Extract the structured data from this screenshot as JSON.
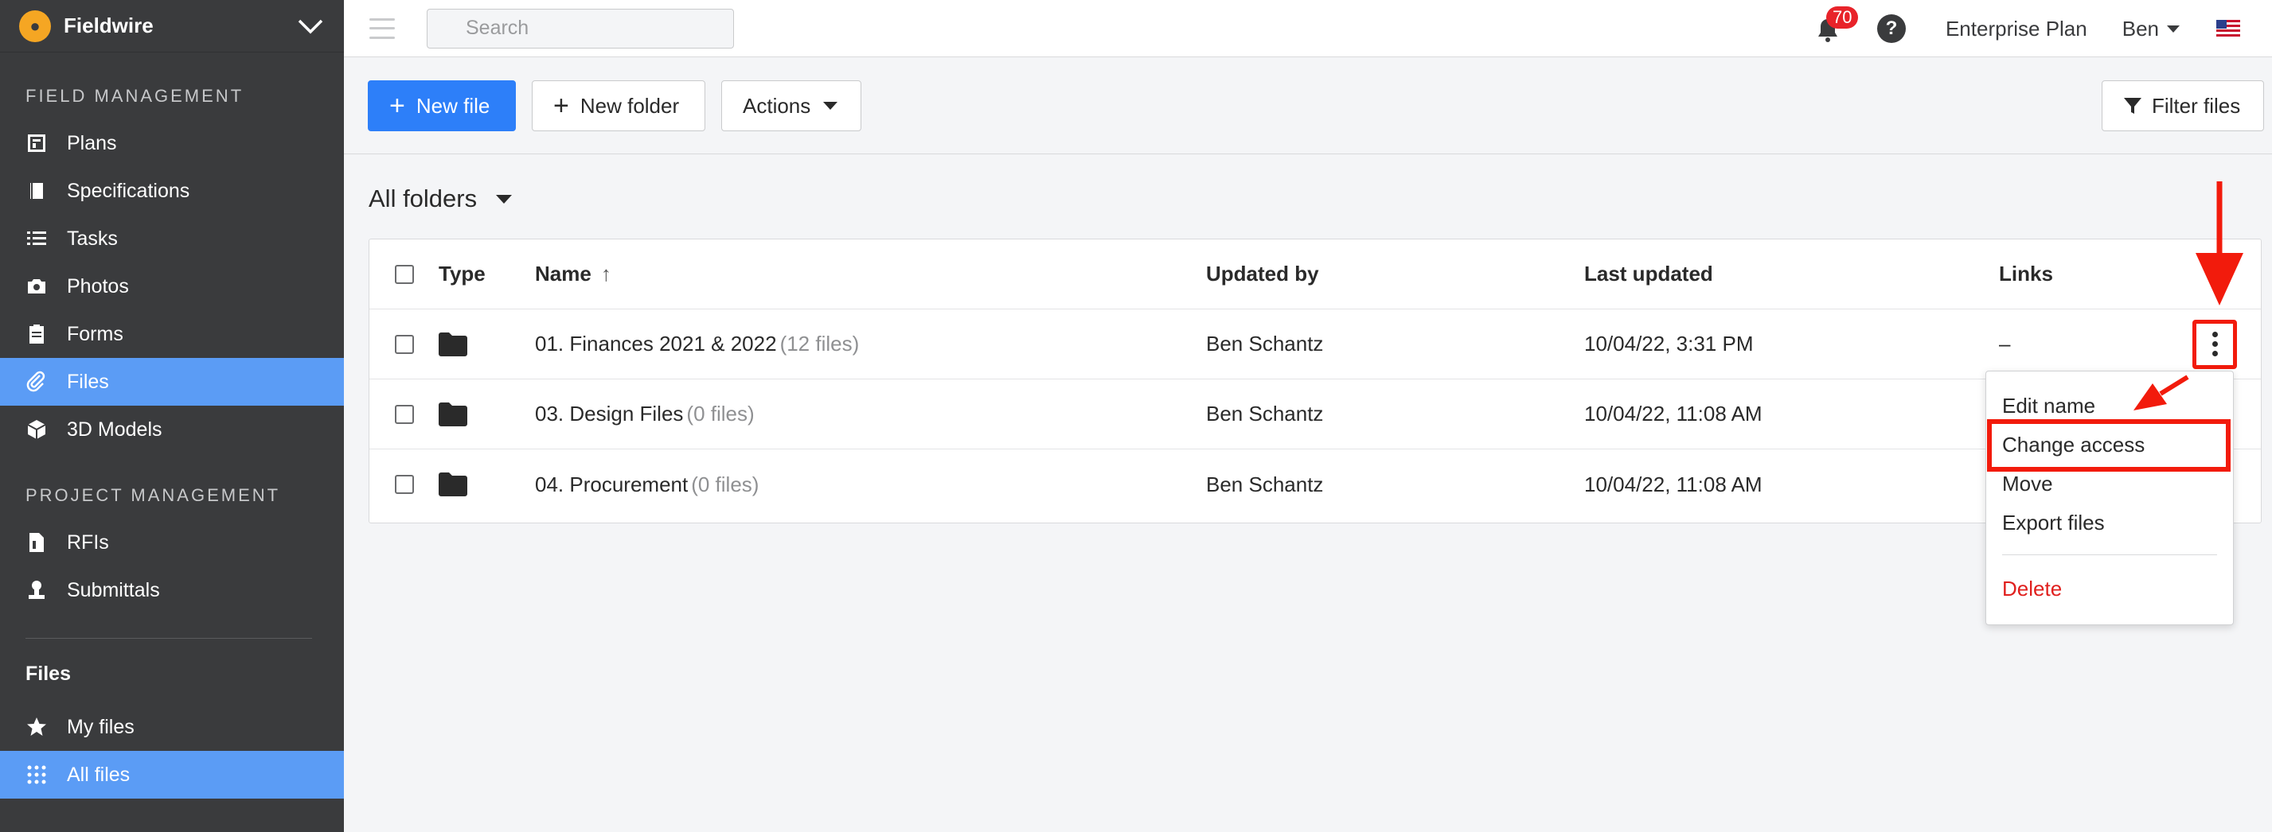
{
  "brand": {
    "name": "Fieldwire",
    "logo": "fieldwire-logo"
  },
  "sidebar": {
    "field_management_title": "FIELD MANAGEMENT",
    "field_items": [
      {
        "label": "Plans",
        "icon": "plans-icon"
      },
      {
        "label": "Specifications",
        "icon": "book-icon"
      },
      {
        "label": "Tasks",
        "icon": "list-icon"
      },
      {
        "label": "Photos",
        "icon": "camera-icon"
      },
      {
        "label": "Forms",
        "icon": "clipboard-icon"
      },
      {
        "label": "Files",
        "icon": "paperclip-icon",
        "active": true
      },
      {
        "label": "3D Models",
        "icon": "cube-icon"
      }
    ],
    "project_management_title": "PROJECT MANAGEMENT",
    "project_items": [
      {
        "label": "RFIs",
        "icon": "document-icon"
      },
      {
        "label": "Submittals",
        "icon": "stamp-icon"
      }
    ],
    "files_title": "Files",
    "files_items": [
      {
        "label": "My files",
        "icon": "star-icon"
      },
      {
        "label": "All files",
        "icon": "grid-icon",
        "active": true
      }
    ]
  },
  "topbar": {
    "search_placeholder": "Search",
    "notification_count": "70",
    "help_label": "?",
    "plan": "Enterprise Plan",
    "user": "Ben"
  },
  "toolbar": {
    "new_file": "New file",
    "new_folder": "New folder",
    "actions": "Actions",
    "filter_files": "Filter files"
  },
  "folders_heading": "All folders",
  "table": {
    "headers": {
      "type": "Type",
      "name": "Name",
      "updated_by": "Updated by",
      "last_updated": "Last updated",
      "links": "Links"
    },
    "rows": [
      {
        "name": "01. Finances 2021 & 2022",
        "count": "(12 files)",
        "updated_by": "Ben Schantz",
        "last_updated": "10/04/22, 3:31 PM",
        "links": "–"
      },
      {
        "name": "03. Design Files",
        "count": "(0 files)",
        "updated_by": "Ben Schantz",
        "last_updated": "10/04/22, 11:08 AM",
        "links": ""
      },
      {
        "name": "04. Procurement",
        "count": "(0 files)",
        "updated_by": "Ben Schantz",
        "last_updated": "10/04/22, 11:08 AM",
        "links": ""
      }
    ]
  },
  "context_menu": {
    "edit_name": "Edit name",
    "change_access": "Change access",
    "move": "Move",
    "export_files": "Export files",
    "delete": "Delete"
  },
  "colors": {
    "accent": "#2d7ff9",
    "sidebar": "#3a3b3d",
    "active": "#5b9cf5",
    "annotation": "#f21b0c",
    "danger": "#e0201e"
  }
}
